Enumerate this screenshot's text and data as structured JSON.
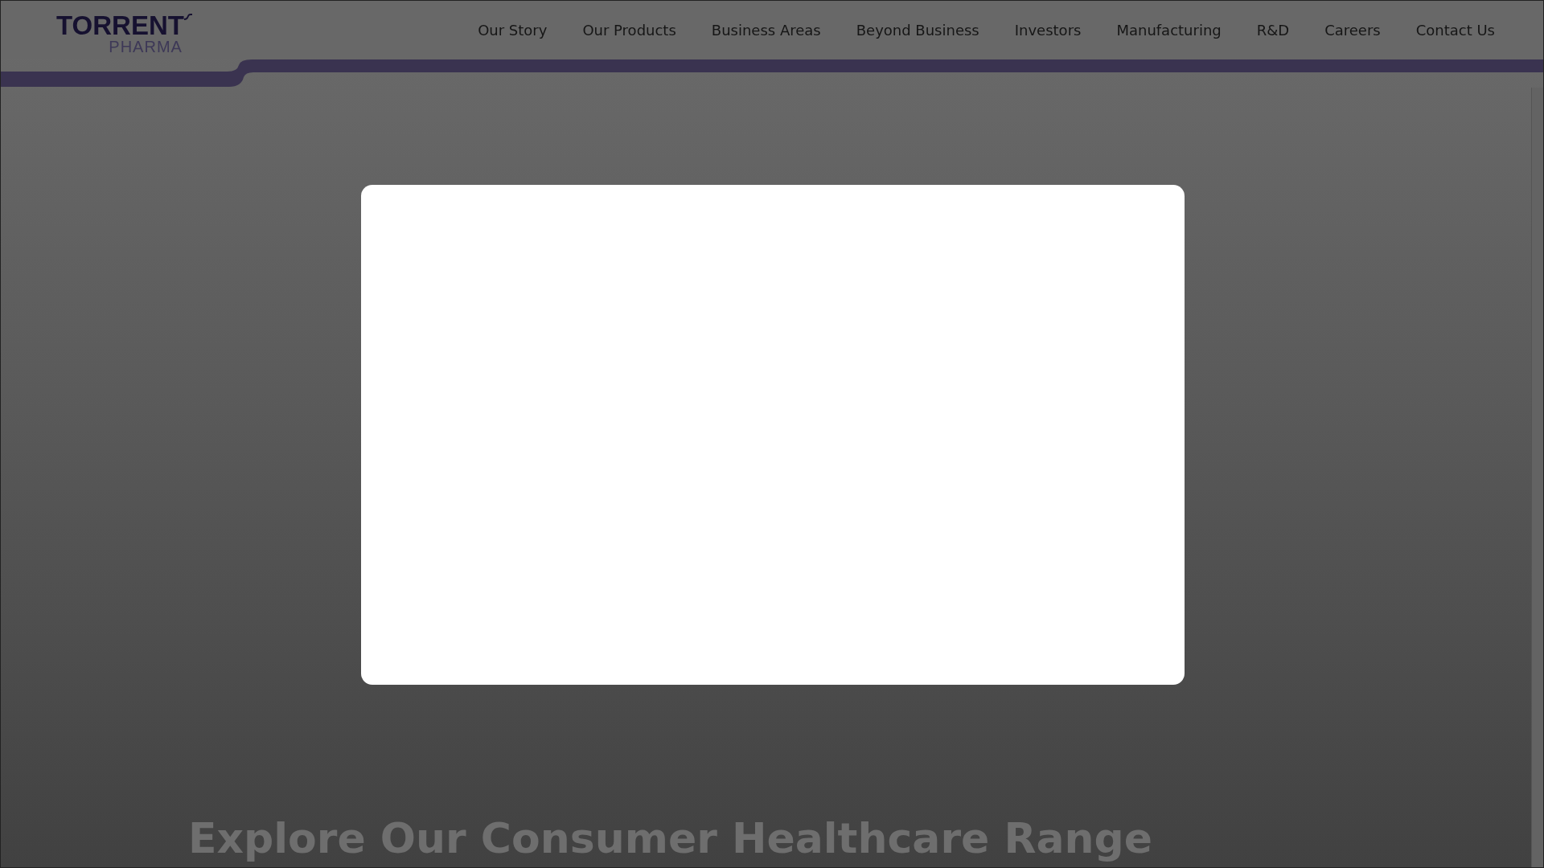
{
  "logo": {
    "name": "TORRENT",
    "tagline": "PHARMA"
  },
  "nav": [
    {
      "label": "Our Story"
    },
    {
      "label": "Our Products"
    },
    {
      "label": "Business Areas"
    },
    {
      "label": "Beyond Business"
    },
    {
      "label": "Investors"
    },
    {
      "label": "Manufacturing"
    },
    {
      "label": "R&D"
    },
    {
      "label": "Careers"
    },
    {
      "label": "Contact Us"
    }
  ],
  "section": {
    "heading": "Explore Our Consumer Healthcare Range"
  }
}
